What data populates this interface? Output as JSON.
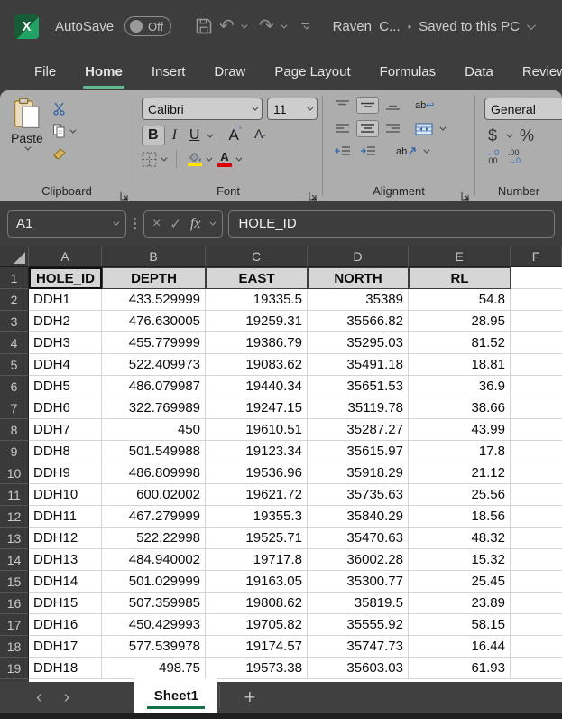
{
  "titlebar": {
    "app_initial": "X",
    "autosave_label": "AutoSave",
    "autosave_state": "Off",
    "doc_title": "Raven_C...",
    "save_separator": "•",
    "save_status": "Saved to this PC"
  },
  "ribbon_tabs": {
    "items": [
      {
        "label": "File",
        "active": false
      },
      {
        "label": "Home",
        "active": true
      },
      {
        "label": "Insert",
        "active": false
      },
      {
        "label": "Draw",
        "active": false
      },
      {
        "label": "Page Layout",
        "active": false
      },
      {
        "label": "Formulas",
        "active": false
      },
      {
        "label": "Data",
        "active": false
      },
      {
        "label": "Review",
        "active": false
      }
    ]
  },
  "ribbon": {
    "clipboard": {
      "group_label": "Clipboard",
      "paste_label": "Paste"
    },
    "font": {
      "group_label": "Font",
      "font_name": "Calibri",
      "font_size": "11",
      "bold_label": "B",
      "italic_label": "I",
      "underline_label": "U",
      "grow_font_label": "A",
      "shrink_font_label": "A",
      "font_color_label": "A",
      "fill_color_hex": "#ffe600",
      "font_color_hex": "#e00000"
    },
    "alignment": {
      "group_label": "Alignment",
      "wrap_label": "ab",
      "orient_label": "ab"
    },
    "number": {
      "group_label": "Number",
      "format": "General",
      "currency_label": "$",
      "percent_label": "%",
      "inc_dec_top": "←0",
      "inc_dec_bot": ".00",
      "dec_dec_top": ".00",
      "dec_dec_bot": "→0"
    }
  },
  "formula_bar": {
    "name_box": "A1",
    "cancel_label": "×",
    "enter_label": "✓",
    "fx_label": "fx",
    "formula": "HOLE_ID"
  },
  "grid": {
    "col_letters": [
      "A",
      "B",
      "C",
      "D",
      "E",
      "F"
    ],
    "selected_cell": "A1",
    "rows": [
      {
        "num": "1",
        "header": true,
        "cells": [
          "HOLE_ID",
          "DEPTH",
          "EAST",
          "NORTH",
          "RL"
        ]
      },
      {
        "num": "2",
        "cells": [
          "DDH1",
          "433.529999",
          "19335.5",
          "35389",
          "54.8"
        ]
      },
      {
        "num": "3",
        "cells": [
          "DDH2",
          "476.630005",
          "19259.31",
          "35566.82",
          "28.95"
        ]
      },
      {
        "num": "4",
        "cells": [
          "DDH3",
          "455.779999",
          "19386.79",
          "35295.03",
          "81.52"
        ]
      },
      {
        "num": "5",
        "cells": [
          "DDH4",
          "522.409973",
          "19083.62",
          "35491.18",
          "18.81"
        ]
      },
      {
        "num": "6",
        "cells": [
          "DDH5",
          "486.079987",
          "19440.34",
          "35651.53",
          "36.9"
        ]
      },
      {
        "num": "7",
        "cells": [
          "DDH6",
          "322.769989",
          "19247.15",
          "35119.78",
          "38.66"
        ]
      },
      {
        "num": "8",
        "cells": [
          "DDH7",
          "450",
          "19610.51",
          "35287.27",
          "43.99"
        ]
      },
      {
        "num": "9",
        "cells": [
          "DDH8",
          "501.549988",
          "19123.34",
          "35615.97",
          "17.8"
        ]
      },
      {
        "num": "10",
        "cells": [
          "DDH9",
          "486.809998",
          "19536.96",
          "35918.29",
          "21.12"
        ]
      },
      {
        "num": "11",
        "cells": [
          "DDH10",
          "600.02002",
          "19621.72",
          "35735.63",
          "25.56"
        ]
      },
      {
        "num": "12",
        "cells": [
          "DDH11",
          "467.279999",
          "19355.3",
          "35840.29",
          "18.56"
        ]
      },
      {
        "num": "13",
        "cells": [
          "DDH12",
          "522.22998",
          "19525.71",
          "35470.63",
          "48.32"
        ]
      },
      {
        "num": "14",
        "cells": [
          "DDH13",
          "484.940002",
          "19717.8",
          "36002.28",
          "15.32"
        ]
      },
      {
        "num": "15",
        "cells": [
          "DDH14",
          "501.029999",
          "19163.05",
          "35300.77",
          "25.45"
        ]
      },
      {
        "num": "16",
        "cells": [
          "DDH15",
          "507.359985",
          "19808.62",
          "35819.5",
          "23.89"
        ]
      },
      {
        "num": "17",
        "cells": [
          "DDH16",
          "450.429993",
          "19705.82",
          "35555.92",
          "58.15"
        ]
      },
      {
        "num": "18",
        "cells": [
          "DDH17",
          "577.539978",
          "19174.57",
          "35747.73",
          "16.44"
        ]
      },
      {
        "num": "19",
        "cells": [
          "DDH18",
          "498.75",
          "19573.38",
          "35603.03",
          "61.93"
        ]
      }
    ]
  },
  "sheet_bar": {
    "tabs": [
      {
        "label": "Sheet1",
        "active": true
      }
    ],
    "new_sheet_label": "+",
    "accent_green": "#157347"
  }
}
